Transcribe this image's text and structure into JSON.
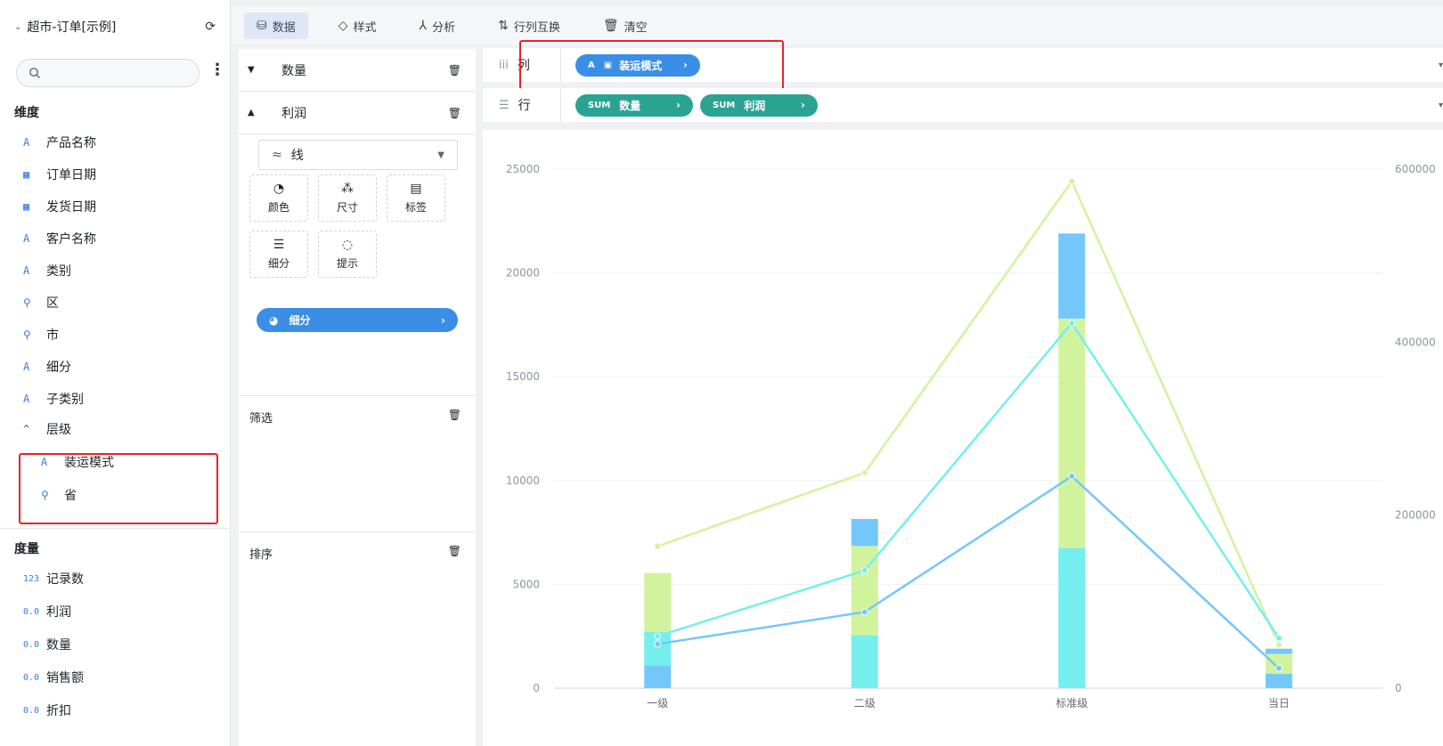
{
  "left_panel": {
    "dataset_name": "超市-订单[示例]",
    "search_placeholder": "",
    "dimensions_title": "维度",
    "dimensions": [
      {
        "icon": "A",
        "label": "产品名称"
      },
      {
        "icon": "calendar",
        "label": "订单日期"
      },
      {
        "icon": "calendar",
        "label": "发货日期"
      },
      {
        "icon": "A",
        "label": "客户名称"
      },
      {
        "icon": "A",
        "label": "类别"
      },
      {
        "icon": "location",
        "label": "区"
      },
      {
        "icon": "location",
        "label": "市"
      },
      {
        "icon": "A",
        "label": "细分"
      },
      {
        "icon": "A",
        "label": "子类别"
      }
    ],
    "hierarchy": {
      "label": "层级",
      "children": [
        {
          "icon": "A",
          "label": "装运模式"
        },
        {
          "icon": "location",
          "label": "省"
        }
      ]
    },
    "measures_title": "度量",
    "measures": [
      {
        "icon": "123",
        "label": "记录数"
      },
      {
        "icon": "0.0",
        "label": "利润"
      },
      {
        "icon": "0.0",
        "label": "数量"
      },
      {
        "icon": "0.0",
        "label": "销售额"
      },
      {
        "icon": "0.0",
        "label": "折扣"
      }
    ]
  },
  "toolbar": {
    "data": "数据",
    "style": "样式",
    "analysis": "分析",
    "swap": "行列互换",
    "clear": "清空"
  },
  "mark_panel": {
    "quantity": "数量",
    "profit": "利润",
    "chart_type": "线",
    "buttons": {
      "color": "颜色",
      "size": "尺寸",
      "label": "标签",
      "detail": "细分",
      "tooltip": "提示"
    },
    "segment_pill": "细分",
    "filter": "筛选",
    "sort": "排序"
  },
  "shelves": {
    "columns_label": "列",
    "rows_label": "行",
    "column_chip": "装运模式",
    "column_chip_tag": "A",
    "row_chips": [
      {
        "tag": "SUM",
        "label": "数量"
      },
      {
        "tag": "SUM",
        "label": "利润"
      }
    ]
  },
  "colors": {
    "accent": "#3a8ee6",
    "teal": "#2ba393",
    "highlight_box": "#e4252b",
    "series_green": "#d2f39e",
    "series_cyan": "#75eeee",
    "series_blue": "#74c7fb"
  },
  "chart_data": {
    "type": "bar",
    "categories": [
      "一级",
      "二级",
      "标准级",
      "当日"
    ],
    "left_axis": {
      "ticks": [
        "0",
        "5000",
        "10000",
        "15000",
        "20000",
        "25000"
      ],
      "ylim": [
        0,
        25000
      ]
    },
    "right_axis": {
      "ticks": [
        "0",
        "200000",
        "400000",
        "600000"
      ],
      "ylim": [
        0,
        600000
      ]
    },
    "bar_stacks": [
      {
        "color": "#74c7fb",
        "values": [
          1100,
          0,
          0,
          700
        ]
      },
      {
        "color": "#75eeee",
        "values": [
          1600,
          2550,
          6750,
          0
        ]
      },
      {
        "color": "#d2f39e",
        "values": [
          2850,
          4300,
          11050,
          950
        ]
      },
      {
        "color": "#74c7fb",
        "values": [
          0,
          1300,
          4100,
          250
        ]
      }
    ],
    "line_series": [
      {
        "color": "#d2f39e",
        "values": [
          164000,
          249000,
          586000,
          50000
        ]
      },
      {
        "color": "#75eeee",
        "values": [
          60000,
          136000,
          422000,
          58000
        ]
      },
      {
        "color": "#74c7fb",
        "values": [
          51000,
          88000,
          245000,
          23000
        ]
      }
    ],
    "grid": true
  }
}
